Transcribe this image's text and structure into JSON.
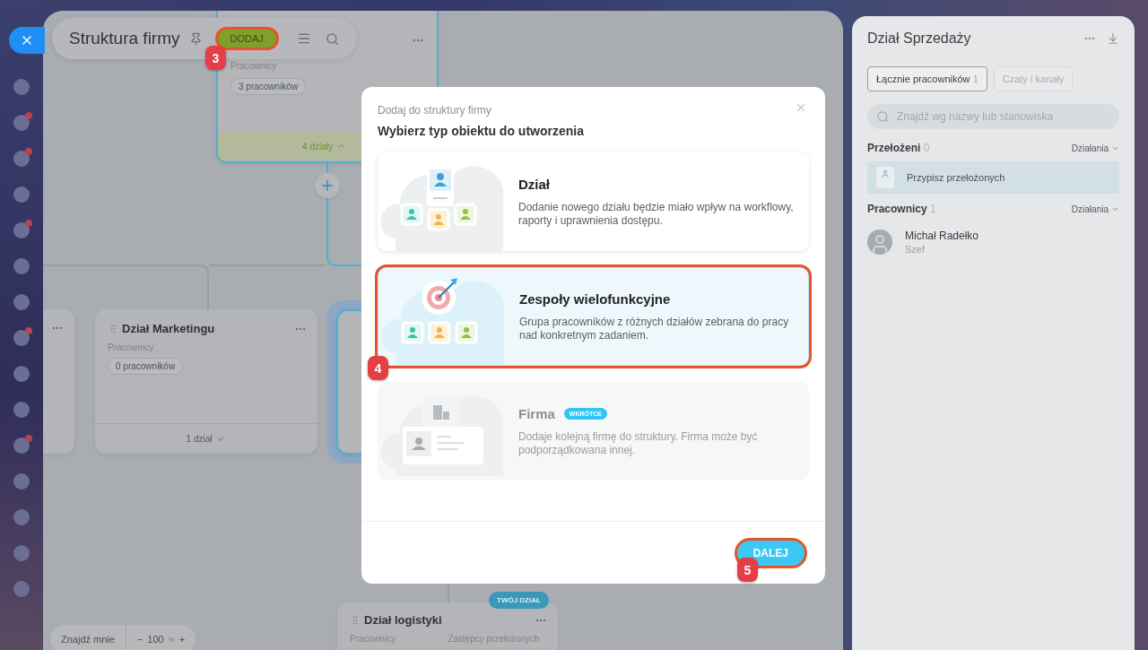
{
  "header": {
    "title": "Struktura firmy",
    "add_button": {
      "label": "DODAJ",
      "step": "3"
    }
  },
  "nodes": [
    {
      "kind": "root",
      "label": "Pracownicy",
      "count": "3 pracowników",
      "footer": "4 działy",
      "expanded": true
    },
    {
      "kind": "stub"
    },
    {
      "kind": "department",
      "title": "Dział Marketingu",
      "label": "Pracownicy",
      "count": "0 pracowników",
      "footer": "1 dział",
      "expanded": false
    },
    {
      "kind": "selected_stub"
    },
    {
      "kind": "bottom",
      "title": "Dział logistyki",
      "badge": "TWÓJ DZIAŁ",
      "labels": [
        "Pracownicy",
        "Zastępcy przełożonych"
      ]
    }
  ],
  "zoom_bar": {
    "find_me": "Znajdź mnie",
    "minus": "−",
    "value": "100",
    "unit": "%",
    "plus": "+"
  },
  "side_panel": {
    "title": "Dział Sprzedaży",
    "tabs": [
      {
        "label": "Łącznie pracowników",
        "count": "1",
        "selected": true
      },
      {
        "label": "Czaty i kanały",
        "selected": false
      }
    ],
    "search": {
      "placeholder": "Znajdź wg nazwy lub stanowiska"
    },
    "sections": [
      {
        "title": "Przełożeni",
        "count": "0",
        "action": "Działania",
        "items": [
          {
            "kind": "assign",
            "name": "Przypisz przełożonych"
          }
        ]
      },
      {
        "title": "Pracownicy",
        "count": "1",
        "action": "Działania",
        "items": [
          {
            "kind": "person",
            "name": "Michał Radełko",
            "role": "Szef"
          }
        ]
      }
    ]
  },
  "modal": {
    "subtitle": "Dodaj do struktury firmy",
    "title": "Wybierz typ obiektu do utworzenia",
    "options": [
      {
        "kind": "department",
        "title": "Dział",
        "description": "Dodanie nowego działu będzie miało wpływ na workflowy, raporty i uprawnienia dostępu.",
        "selected": false,
        "disabled": false
      },
      {
        "kind": "team",
        "title": "Zespoły wielofunkcyjne",
        "description": "Grupa pracowników z różnych działów zebrana do pracy nad konkretnym zadaniem.",
        "selected": true,
        "disabled": false,
        "step": "4"
      },
      {
        "kind": "company",
        "title": "Firma",
        "badge": "WKRÓTCE",
        "description": "Dodaje kolejną firmę do struktury. Firma może być podporządkowana innej.",
        "selected": false,
        "disabled": true
      }
    ],
    "next_button": {
      "label": "DALEJ",
      "step": "5"
    }
  }
}
